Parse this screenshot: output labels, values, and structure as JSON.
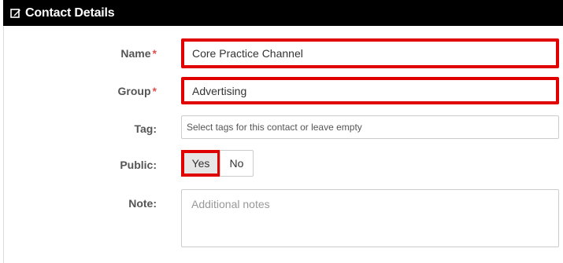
{
  "header": {
    "title": "Contact Details",
    "icon": "edit-icon"
  },
  "form": {
    "name": {
      "label": "Name",
      "required_mark": "*",
      "value": "Core Practice Channel"
    },
    "group": {
      "label": "Group",
      "required_mark": "*",
      "value": "Advertising"
    },
    "tag": {
      "label": "Tag:",
      "placeholder": "Select tags for this contact or leave empty"
    },
    "public": {
      "label": "Public:",
      "options": [
        "Yes",
        "No"
      ],
      "selected": "Yes"
    },
    "note": {
      "label": "Note:",
      "placeholder": "Additional notes"
    }
  },
  "colors": {
    "header_bg": "#000000",
    "highlight": "#e00000",
    "required": "#d9534f",
    "label_text": "#555555"
  }
}
